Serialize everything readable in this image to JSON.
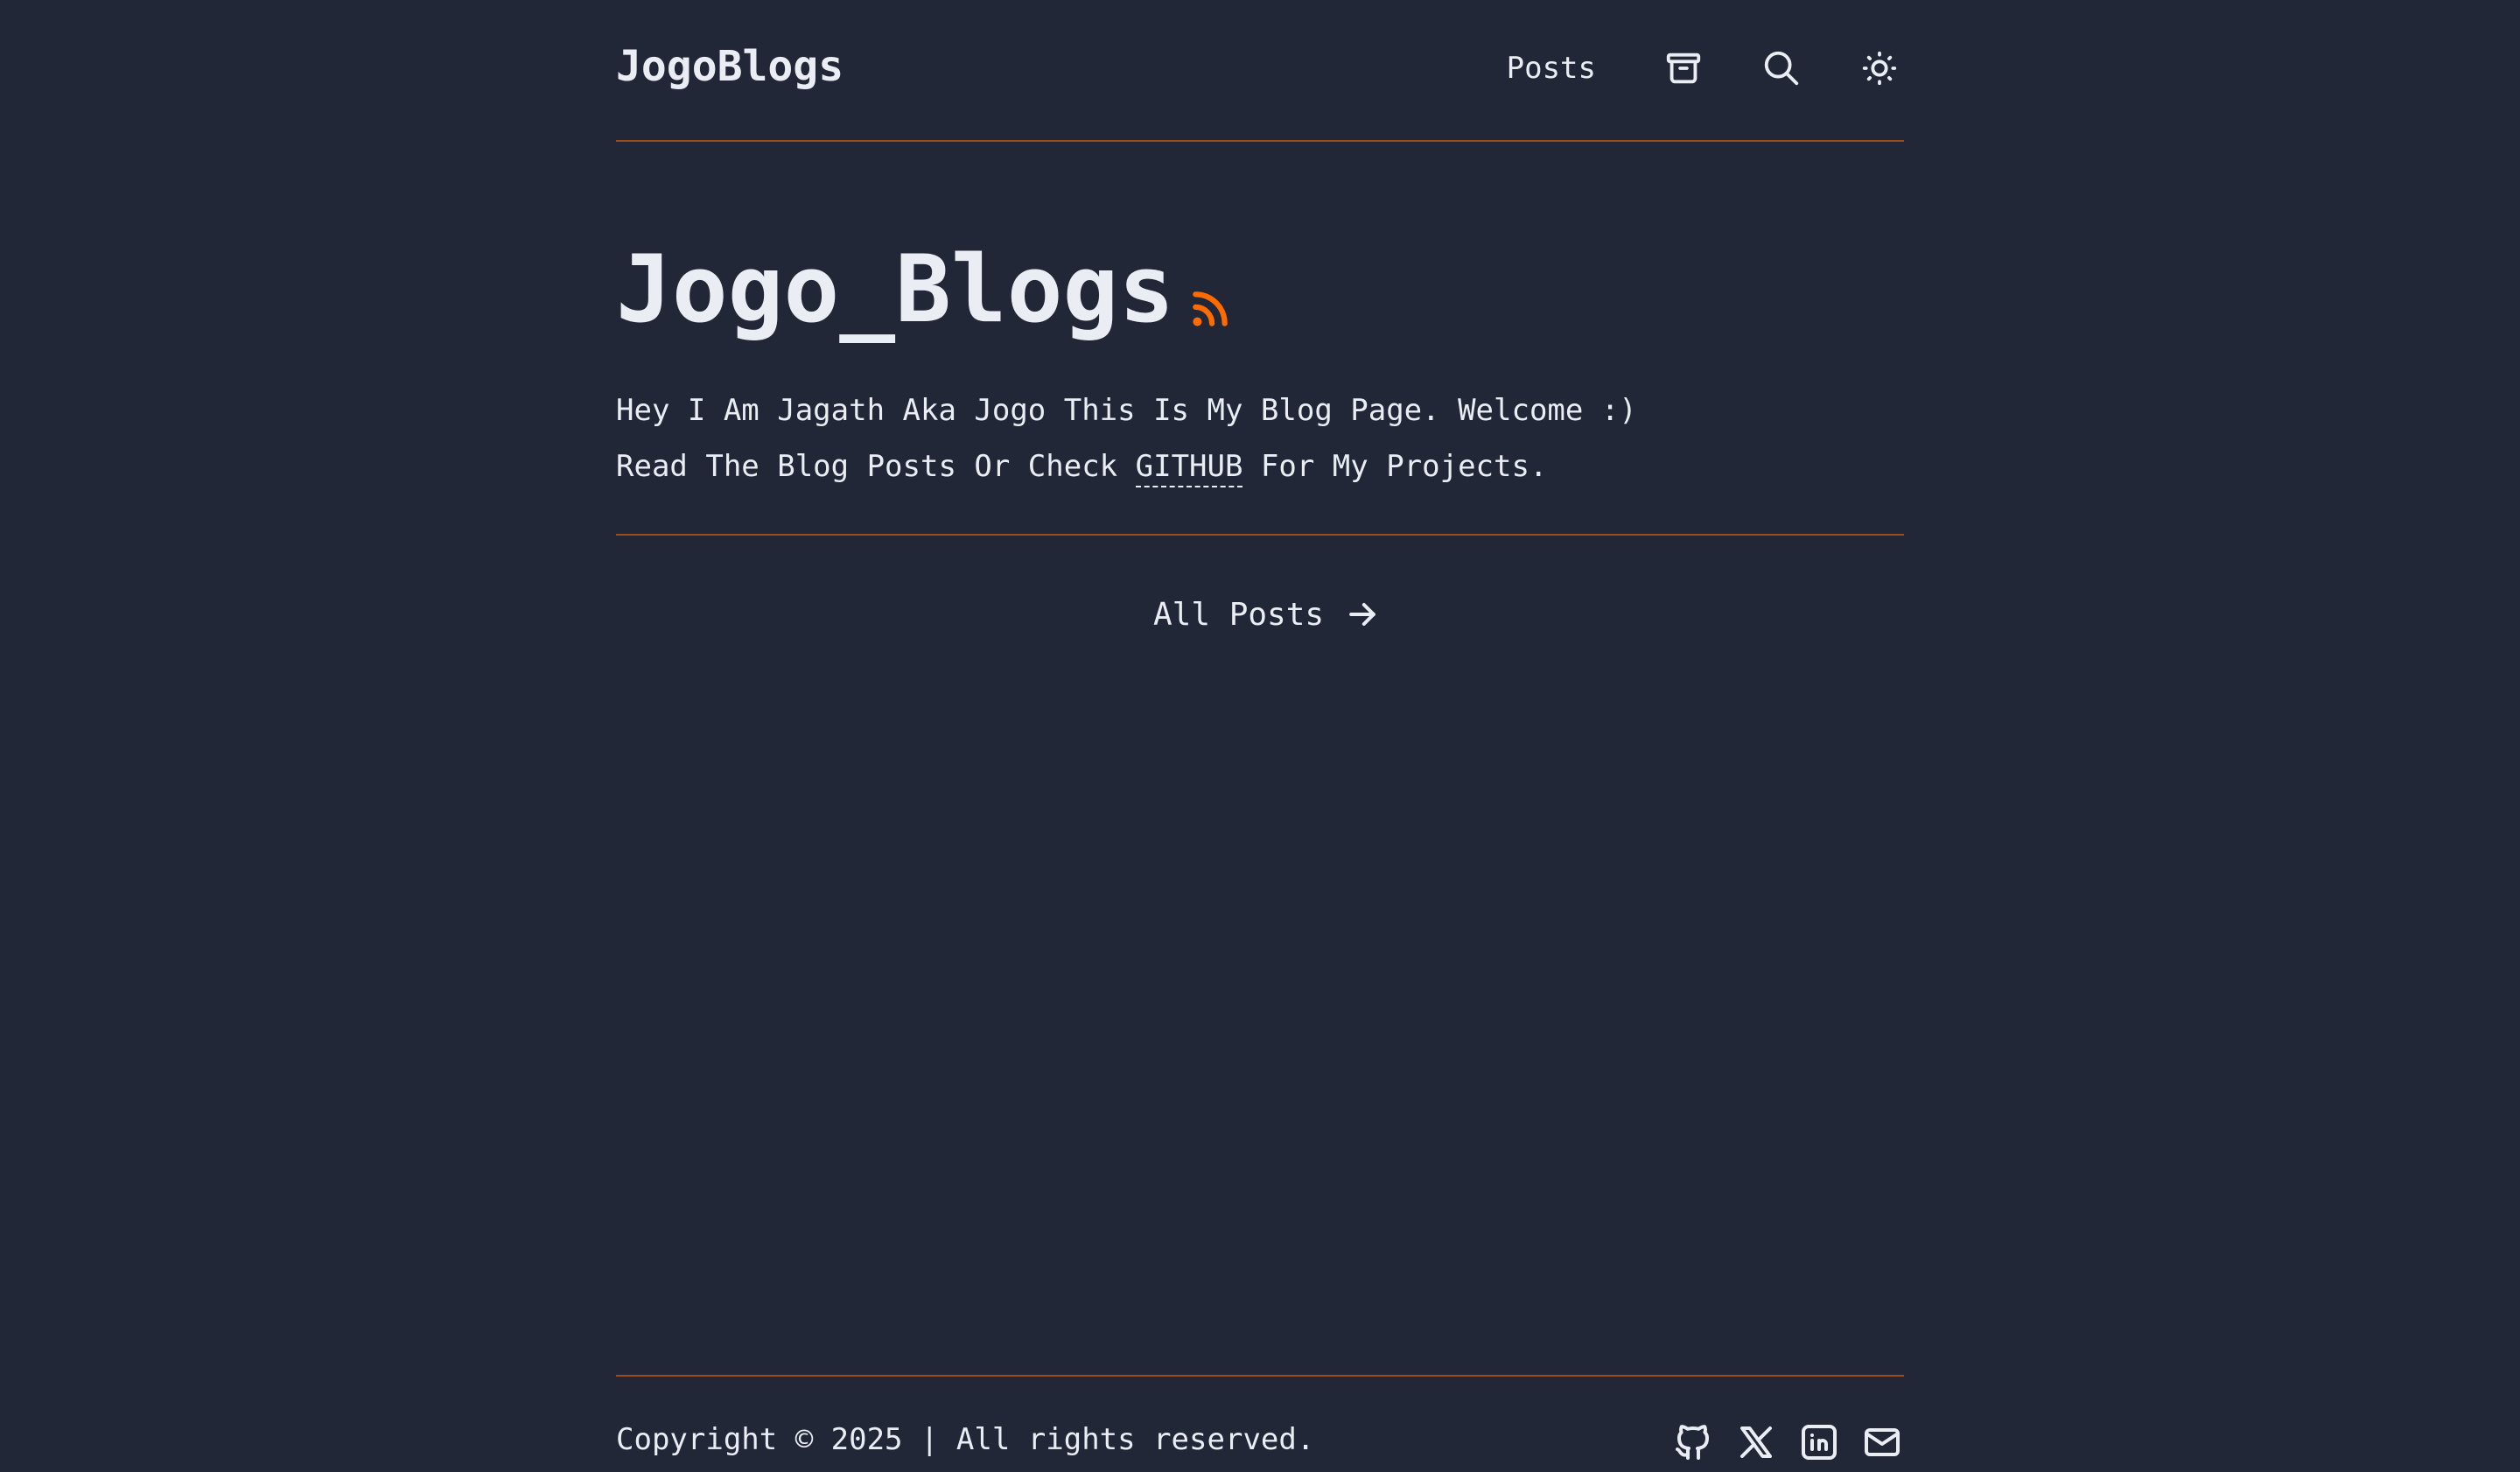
{
  "header": {
    "logo": "JogoBlogs",
    "nav": {
      "posts_label": "Posts",
      "icons": [
        "archive-icon",
        "search-icon",
        "sun-icon"
      ]
    }
  },
  "hero": {
    "title": "Jogo_Blogs",
    "rss_icon": "rss-icon",
    "line1": "Hey I Am Jagath Aka Jogo This Is My Blog Page. Welcome :)",
    "line2_prefix": "Read The Blog Posts Or Check ",
    "github_link": "GITHUB",
    "line2_suffix": " For My Projects."
  },
  "all_posts": {
    "label": "All Posts",
    "icon": "arrow-right-icon"
  },
  "footer": {
    "copyright": "Copyright © 2025 | All rights reserved.",
    "socials": [
      "github-icon",
      "x-icon",
      "linkedin-icon",
      "mail-icon"
    ]
  },
  "colors": {
    "background": "#212737",
    "text": "#eaedf3",
    "accent": "#ff6b01"
  }
}
